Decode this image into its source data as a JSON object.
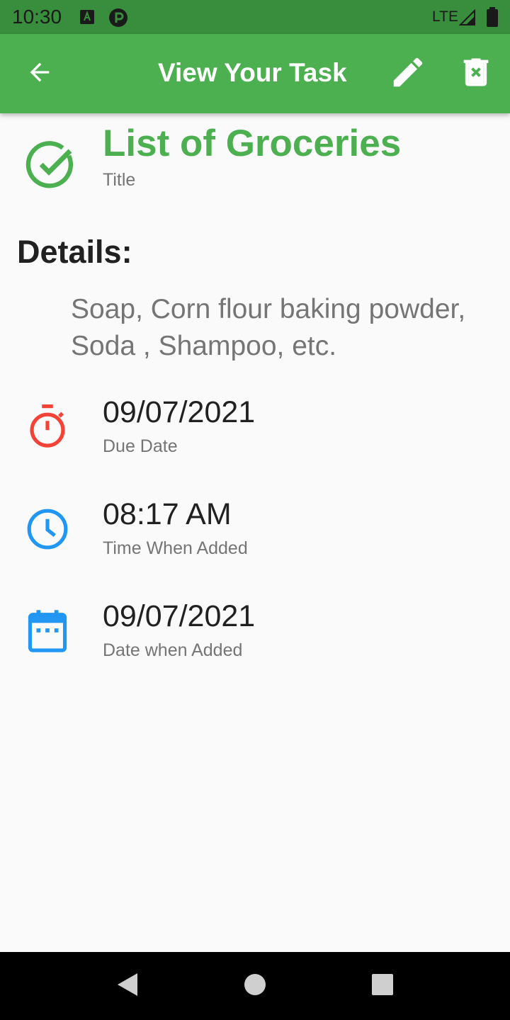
{
  "status_bar": {
    "time": "10:30",
    "network": "LTE",
    "icons": [
      "a-notification-icon",
      "p-notification-icon",
      "signal-icon",
      "battery-icon"
    ]
  },
  "app_bar": {
    "title": "View Your Task",
    "color": "#4caf50",
    "icons": [
      "back-arrow-icon",
      "edit-pencil-icon",
      "delete-icon"
    ]
  },
  "task": {
    "title": "List of Groceries",
    "title_caption": "Title",
    "title_icon": "check-circle-icon",
    "title_color": "#4caf50",
    "details_heading": "Details:",
    "details_text": "Soap, Corn flour baking powder, Soda , Shampoo, etc.",
    "rows": [
      {
        "value": "09/07/2021",
        "caption": "Due Date",
        "icon": "timer-icon",
        "icon_color": "#f44336"
      },
      {
        "value": "08:17 AM",
        "caption": "Time When Added",
        "icon": "clock-icon",
        "icon_color": "#2196f3"
      },
      {
        "value": "09/07/2021",
        "caption": "Date when Added",
        "icon": "calendar-icon",
        "icon_color": "#2196f3"
      }
    ]
  },
  "nav_bar": {
    "icons": [
      "nav-back-icon",
      "nav-home-icon",
      "nav-recents-icon"
    ]
  }
}
